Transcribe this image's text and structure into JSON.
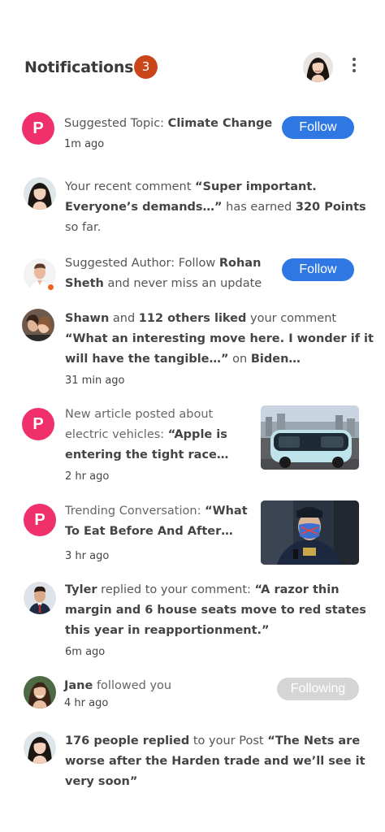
{
  "header": {
    "title": "Notifications",
    "count": "3",
    "colors": {
      "badge": "#c8461a",
      "follow_button": "#2f78e4",
      "p_avatar": "#f0306a"
    }
  },
  "icons": {
    "menu": "more-vertical-icon",
    "avatar": "user-avatar",
    "brand": "P"
  },
  "notifications": [
    {
      "type": "suggested-topic",
      "prefix": "Suggested Topic: ",
      "bold": "Climate Change",
      "time": "1m ago",
      "action": "Follow"
    },
    {
      "type": "points",
      "line1_prefix": "Your recent comment ",
      "line1_bold": "“Super important.",
      "line2_bold": "Everyone’s demands…”",
      "line2_suffix": " has earned ",
      "line2_bold2": "320 Points",
      "line3": "so far."
    },
    {
      "type": "suggested-author",
      "line1_prefix": "Suggested Author: Follow ",
      "line1_bold": "Rohan",
      "line2_bold": "Sheth",
      "line2_suffix": " and never miss an update",
      "action": "Follow"
    },
    {
      "type": "likes",
      "line1_bold": "Shawn",
      "line1_mid": " and ",
      "line1_bold2": "112 others liked",
      "line1_suffix": " your comment",
      "line2_bold": "“What an interesting move here. I wonder if it",
      "line3_bold": "will have the tangible…”",
      "line3_mid": " on ",
      "line3_bold2": "Biden…",
      "time": "31 min ago"
    },
    {
      "type": "new-article",
      "line1": "New article posted about",
      "line2_prefix": "electric vehicles: ",
      "line2_bold": "“Apple is",
      "line3_bold": "entering the tight race…",
      "time": "2 hr ago"
    },
    {
      "type": "trending",
      "line1_prefix": "Trending Conversation: ",
      "line1_bold": "“What",
      "line2_bold": "To Eat Before And After…",
      "time": "3 hr ago"
    },
    {
      "type": "reply",
      "line1_bold": "Tyler",
      "line1_mid": " replied to your comment: ",
      "line1_bold2": "“A razor thin",
      "line2_bold": "margin and 6 house seats move to red states",
      "line3_bold": "this year in reapportionment.”",
      "time": "6m ago"
    },
    {
      "type": "follow",
      "bold": "Jane",
      "suffix": " followed you",
      "time": "4 hr ago",
      "action": "Following"
    },
    {
      "type": "post-replies",
      "line1_bold": "176 people replied",
      "line1_mid": " to your Post ",
      "line1_bold2": "“The Nets are",
      "line2_bold": "worse after the Harden trade and we’ll see it",
      "line3_bold": "very soon”"
    }
  ]
}
